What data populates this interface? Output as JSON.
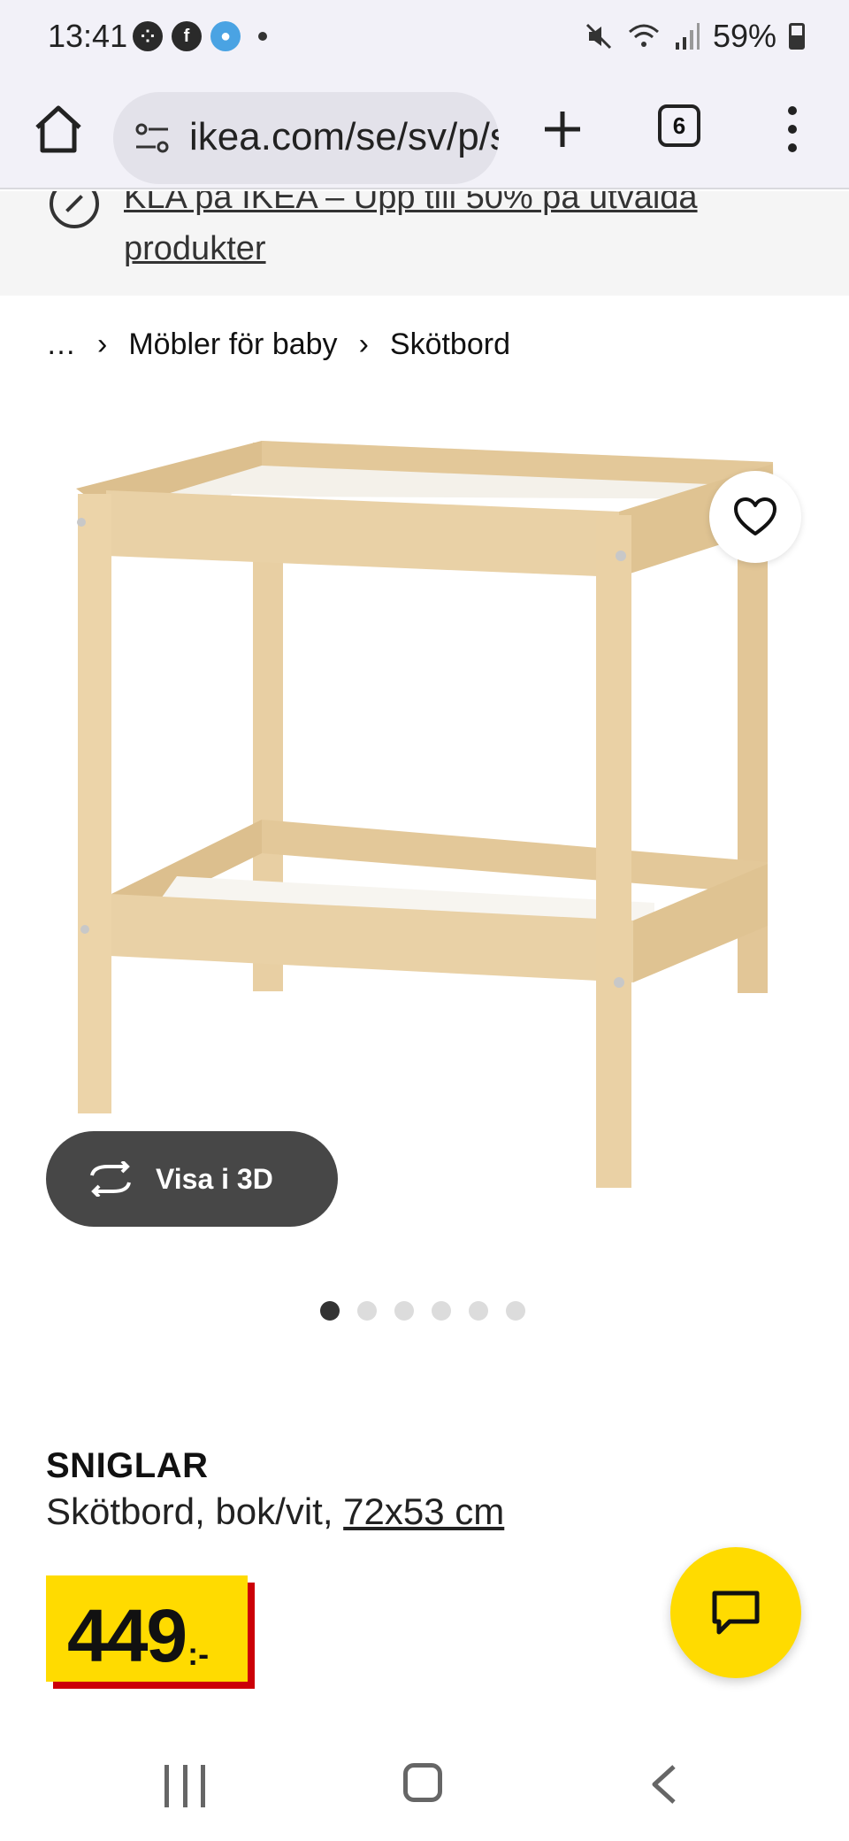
{
  "status_bar": {
    "time": "13:41",
    "battery": "59%"
  },
  "browser": {
    "url": "ikea.com/se/sv/p/s",
    "tab_count": "6"
  },
  "promo": {
    "text": "KLA på IKEA – Upp till 50% på utvalda produkter"
  },
  "breadcrumb": {
    "ellipsis": "…",
    "items": [
      "Möbler för baby",
      "Skötbord"
    ]
  },
  "gallery": {
    "view_3d_label": "Visa i 3D",
    "image_count": 6,
    "active_index": 0
  },
  "product": {
    "name": "SNIGLAR",
    "description": "Skötbord, bok/vit,",
    "size": "72x53 cm",
    "price": "449",
    "price_suffix": ":-"
  },
  "colors": {
    "price_yellow": "#ffdb00",
    "price_red": "#cc0008",
    "chat_yellow": "#ffdb00"
  }
}
